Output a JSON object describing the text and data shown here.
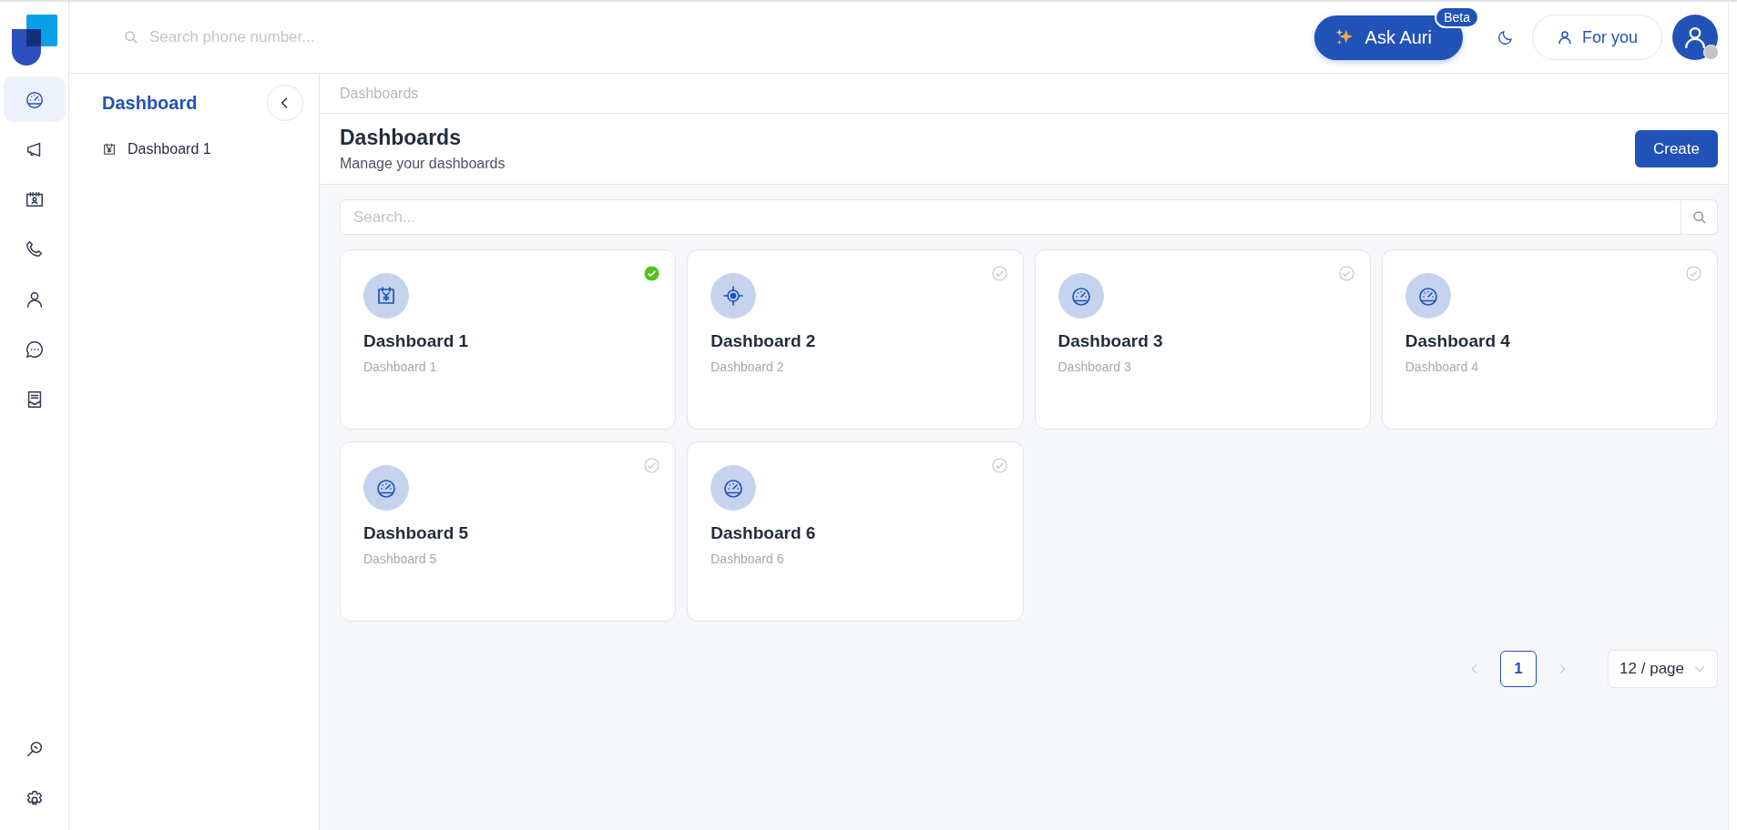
{
  "rail": {
    "items": [
      {
        "kind": "gauge",
        "selected": true
      },
      {
        "kind": "megaphone",
        "selected": false
      },
      {
        "kind": "calendar-person",
        "selected": false
      },
      {
        "kind": "phone",
        "selected": false
      },
      {
        "kind": "person",
        "selected": false
      },
      {
        "kind": "chat",
        "selected": false
      },
      {
        "kind": "receipt",
        "selected": false
      }
    ],
    "bottom": [
      {
        "kind": "zoom"
      },
      {
        "kind": "gear"
      }
    ]
  },
  "top_bar": {
    "search": {
      "placeholder": "Search phone number..."
    },
    "ask_button": {
      "label": "Ask Auri",
      "badge": "Beta"
    },
    "for_you_button": {
      "label": "For you"
    }
  },
  "side_panel": {
    "title": "Dashboard",
    "items": [
      {
        "label": "Dashboard 1",
        "kind": "calendar-yen"
      }
    ]
  },
  "breadcrumb": "Dashboards",
  "header": {
    "title": "Dashboards",
    "subtitle": "Manage your dashboards",
    "create_button": "Create"
  },
  "search": {
    "placeholder": "Search..."
  },
  "cards": [
    {
      "title": "Dashboard 1",
      "subtitle": "Dashboard 1",
      "kind": "calendar-yen",
      "selected": true
    },
    {
      "title": "Dashboard 2",
      "subtitle": "Dashboard 2",
      "kind": "target",
      "selected": false
    },
    {
      "title": "Dashboard 3",
      "subtitle": "Dashboard 3",
      "kind": "gauge",
      "selected": false
    },
    {
      "title": "Dashboard 4",
      "subtitle": "Dashboard 4",
      "kind": "gauge",
      "selected": false
    },
    {
      "title": "Dashboard 5",
      "subtitle": "Dashboard 5",
      "kind": "gauge",
      "selected": false
    },
    {
      "title": "Dashboard 6",
      "subtitle": "Dashboard 6",
      "kind": "gauge",
      "selected": false
    }
  ],
  "pagination": {
    "pages": [
      {
        "label": "1",
        "selected": true
      }
    ],
    "page_size": "12 / page"
  }
}
